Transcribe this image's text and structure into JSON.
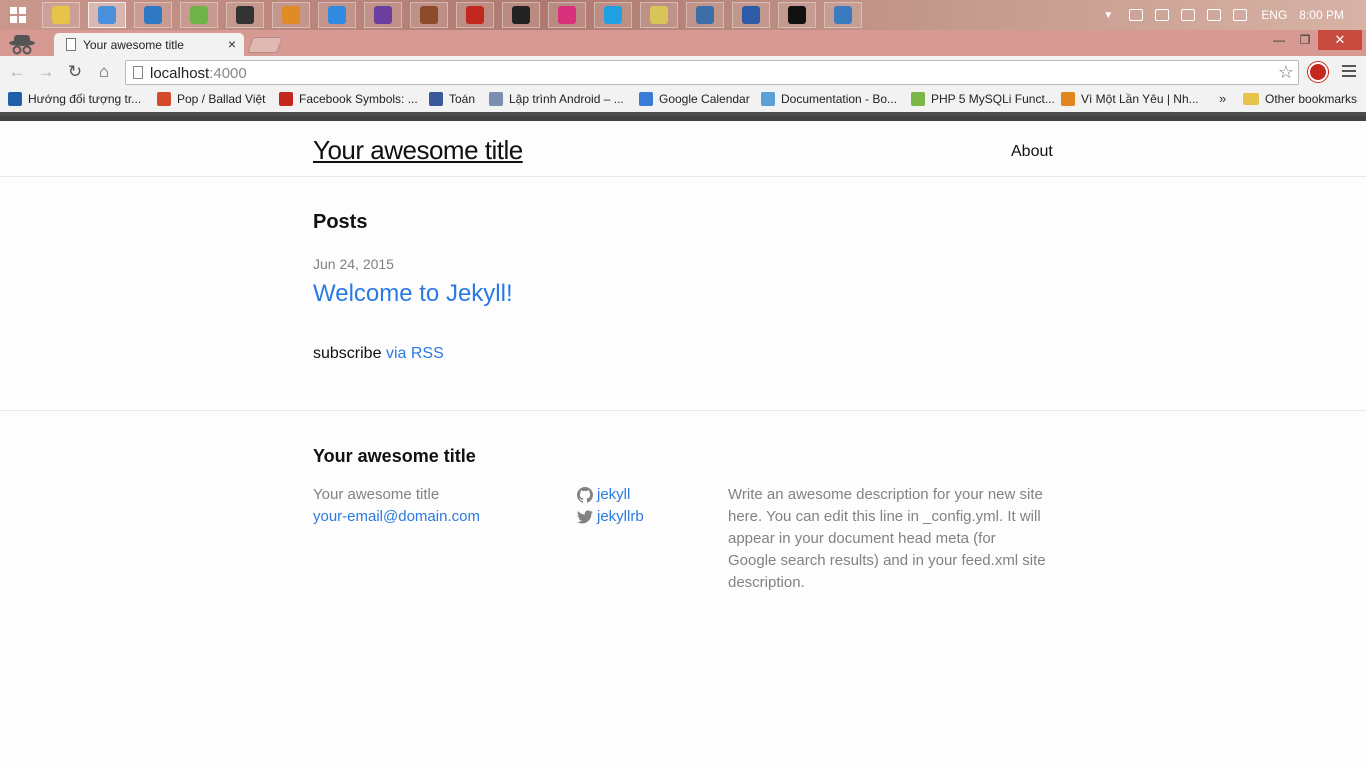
{
  "taskbar": {
    "apps": [
      {
        "name": "explorer",
        "color": "#e8c34a"
      },
      {
        "name": "chrome",
        "color": "#4a8fdb",
        "active": true
      },
      {
        "name": "vpn-app",
        "color": "#2f78c4"
      },
      {
        "name": "notepad-plus",
        "color": "#6fb449"
      },
      {
        "name": "media-app",
        "color": "#333333"
      },
      {
        "name": "archive-app",
        "color": "#e08b23"
      },
      {
        "name": "zalo",
        "color": "#2f8be0"
      },
      {
        "name": "visual-studio",
        "color": "#6b3fa0"
      },
      {
        "name": "photo-app",
        "color": "#8b4a2a"
      },
      {
        "name": "adobe-reader",
        "color": "#c4271d"
      },
      {
        "name": "vnc",
        "color": "#222222"
      },
      {
        "name": "flower-app",
        "color": "#d8307a"
      },
      {
        "name": "skype",
        "color": "#1fa0e3"
      },
      {
        "name": "folder-app",
        "color": "#d9c45a"
      },
      {
        "name": "python",
        "color": "#3c6ea8"
      },
      {
        "name": "doc-app",
        "color": "#2f5aa8"
      },
      {
        "name": "cmd",
        "color": "#111111"
      },
      {
        "name": "remote-desktop",
        "color": "#3a7bc0"
      }
    ],
    "language": "ENG",
    "time": "8:00 PM"
  },
  "browser": {
    "tab_title": "Your awesome title",
    "tab_close": "×",
    "window": {
      "minimize": "—",
      "maximize": "❐",
      "close": "✕"
    },
    "address": {
      "host": "localhost",
      "port": ":4000"
    },
    "bookmarks": [
      {
        "label": "Hướng đối tượng tr...",
        "color": "#1e5fa8"
      },
      {
        "label": "Pop / Ballad Việt",
        "color": "#d44a2b"
      },
      {
        "label": "Facebook Symbols: ...",
        "color": "#c4271d"
      },
      {
        "label": "Toán",
        "color": "#3b5998"
      },
      {
        "label": "Lập trình Android – ...",
        "color": "#7a8fb0"
      },
      {
        "label": "Google Calendar",
        "color": "#3a7bd5"
      },
      {
        "label": "Documentation - Bo...",
        "color": "#5a9fd6"
      },
      {
        "label": "PHP 5 MySQLi Funct...",
        "color": "#7ab648"
      },
      {
        "label": "Vì Một Lần Yêu | Nh...",
        "color": "#e0861d"
      }
    ],
    "bookmarks_overflow": "»",
    "other_bookmarks": "Other bookmarks"
  },
  "site": {
    "title": "Your awesome title",
    "nav_about": "About",
    "posts_heading": "Posts",
    "posts": [
      {
        "date": "Jun 24, 2015",
        "title": "Welcome to Jekyll!"
      }
    ],
    "subscribe_prefix": "subscribe",
    "subscribe_link": "via RSS",
    "footer": {
      "heading": "Your awesome title",
      "name": "Your awesome title",
      "email": "your-email@domain.com",
      "github": "jekyll",
      "twitter": "jekyllrb",
      "description": "Write an awesome description for your new site here. You can edit this line in _config.yml. It will appear in your document head meta (for Google search results) and in your feed.xml site description."
    }
  }
}
